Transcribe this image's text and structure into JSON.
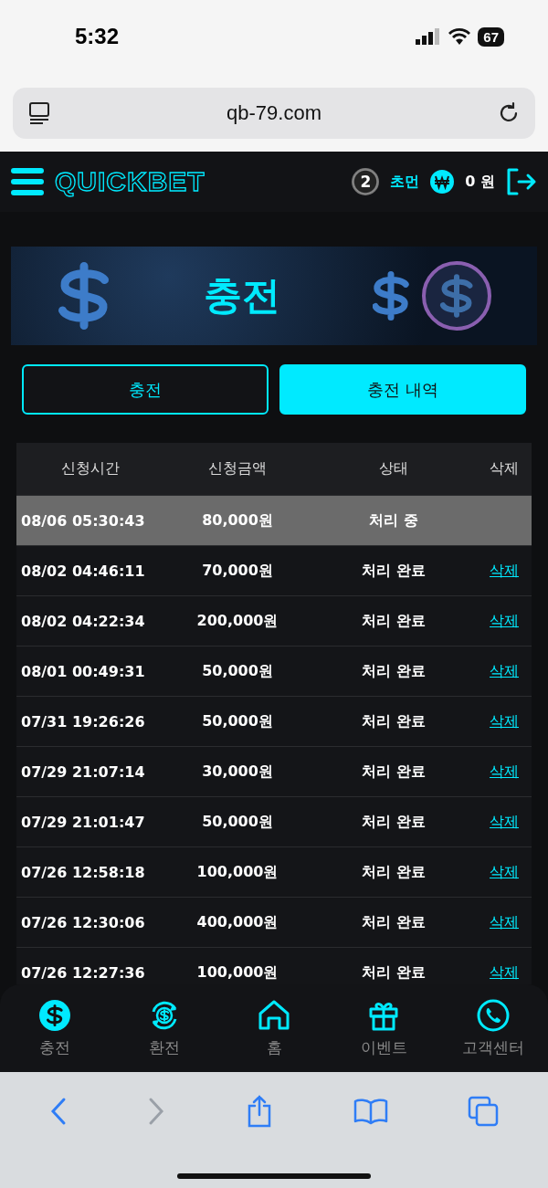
{
  "status_bar": {
    "time": "5:32",
    "battery": "67"
  },
  "browser": {
    "url": "qb-79.com"
  },
  "header": {
    "logo": "QUICKBET",
    "level": "2",
    "nickname": "초먼",
    "balance": "0 원"
  },
  "banner": {
    "title": "충전"
  },
  "tabs": [
    {
      "label": "충전",
      "selected": false
    },
    {
      "label": "충전 내역",
      "selected": true
    }
  ],
  "table": {
    "columns": [
      "신청시간",
      "신청금액",
      "상태",
      "삭제"
    ],
    "rows": [
      {
        "time": "08/06 05:30:43",
        "amount": "80,000원",
        "status": "처리 중",
        "selected": true
      },
      {
        "time": "08/02 04:46:11",
        "amount": "70,000원",
        "status": "처리 완료",
        "delete": "삭제",
        "selected": false
      },
      {
        "time": "08/02 04:22:34",
        "amount": "200,000원",
        "status": "처리 완료",
        "delete": "삭제",
        "selected": false
      },
      {
        "time": "08/01 00:49:31",
        "amount": "50,000원",
        "status": "처리 완료",
        "delete": "삭제",
        "selected": false
      },
      {
        "time": "07/31 19:26:26",
        "amount": "50,000원",
        "status": "처리 완료",
        "delete": "삭제",
        "selected": false
      },
      {
        "time": "07/29 21:07:14",
        "amount": "30,000원",
        "status": "처리 완료",
        "delete": "삭제",
        "selected": false
      },
      {
        "time": "07/29 21:01:47",
        "amount": "50,000원",
        "status": "처리 완료",
        "delete": "삭제",
        "selected": false
      },
      {
        "time": "07/26 12:58:18",
        "amount": "100,000원",
        "status": "처리 완료",
        "delete": "삭제",
        "selected": false
      },
      {
        "time": "07/26 12:30:06",
        "amount": "400,000원",
        "status": "처리 완료",
        "delete": "삭제",
        "selected": false
      },
      {
        "time": "07/26 12:27:36",
        "amount": "100,000원",
        "status": "처리 완료",
        "delete": "삭제",
        "selected": false
      }
    ]
  },
  "bottom_nav": [
    {
      "kind": "dollar",
      "label": "충전"
    },
    {
      "kind": "exchange",
      "label": "환전"
    },
    {
      "kind": "home",
      "label": "홈"
    },
    {
      "kind": "gift",
      "label": "이벤트"
    },
    {
      "kind": "phone",
      "label": "고객센터"
    }
  ],
  "safari_toolbar": {
    "forward_disabled": true
  }
}
